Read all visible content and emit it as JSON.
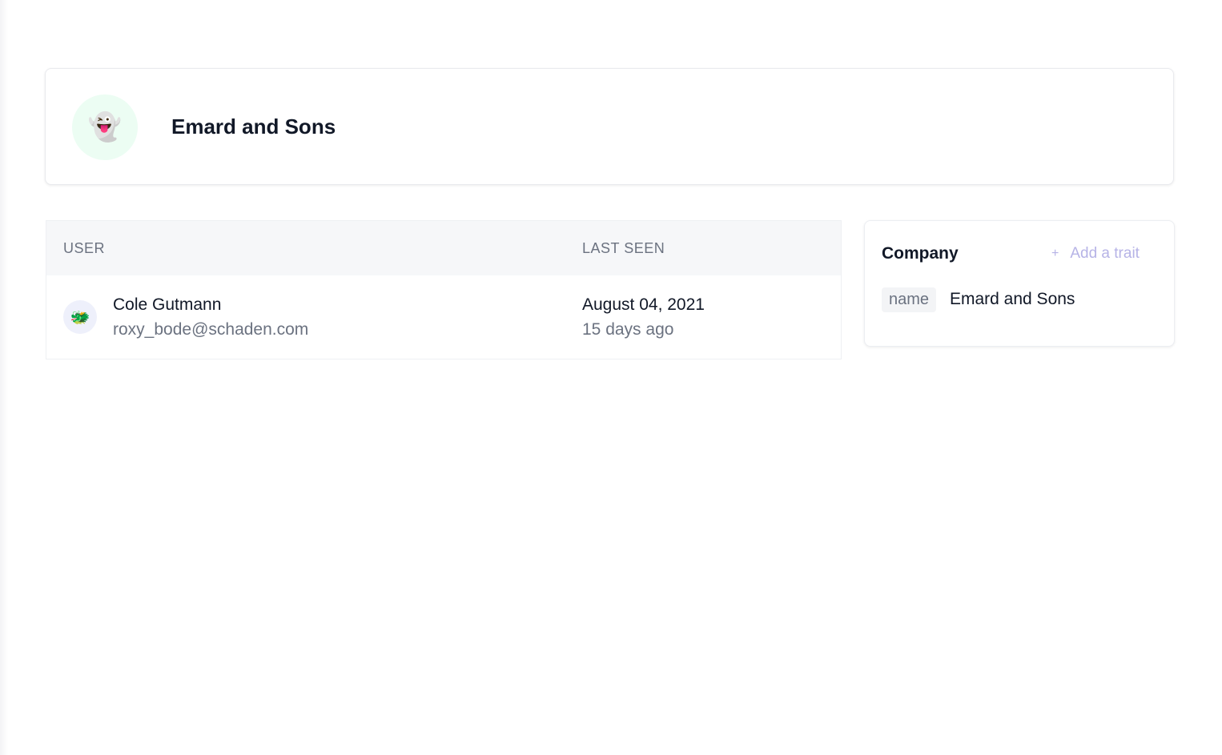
{
  "company": {
    "avatar_icon": "ghost-icon",
    "avatar_glyph": "👻",
    "name": "Emard and Sons"
  },
  "users_table": {
    "columns": [
      "USER",
      "LAST SEEN"
    ],
    "rows": [
      {
        "avatar_icon": "dragon-face-icon",
        "avatar_glyph": "🐲",
        "name": "Cole Gutmann",
        "email": "roxy_bode@schaden.com",
        "last_seen_date": "August 04, 2021",
        "last_seen_relative": "15 days ago"
      }
    ]
  },
  "traits_panel": {
    "title": "Company",
    "add_label": "Add a trait",
    "add_icon_glyph": "+",
    "traits": [
      {
        "key": "name",
        "value": "Emard and Sons"
      }
    ]
  },
  "colors": {
    "accent_light": "#b6b3e6",
    "avatar_bg_company": "#ecfdf3",
    "avatar_bg_user": "#eef0fb"
  }
}
